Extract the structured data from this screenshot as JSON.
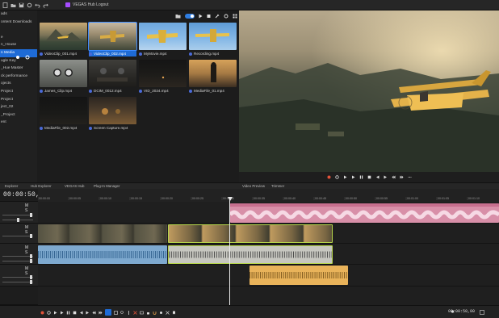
{
  "app": {
    "title": "VEGAS Hub Logout"
  },
  "colors": {
    "accent": "#1e6bd6",
    "record": "#e2533a",
    "pink_clip": "#d88fa8",
    "blue_clip": "#7ea9cf",
    "orange_clip": "#e9b35a",
    "video_clip_border": "#b7d64a"
  },
  "explorer": {
    "items": [
      {
        "label": "ads"
      },
      {
        "label": "ontent Downloads"
      },
      {
        "label": ""
      },
      {
        "label": "e"
      },
      {
        "label": "n_House"
      },
      {
        "label": "n Media",
        "selected": true
      },
      {
        "label": "ugle Key"
      },
      {
        "label": "_Hue Master"
      },
      {
        "label": "ck performance"
      },
      {
        "label": "ojects"
      },
      {
        "label": "Project"
      },
      {
        "label": "Project"
      },
      {
        "label": "ject_02"
      },
      {
        "label": "_Project"
      },
      {
        "label": "ent"
      }
    ]
  },
  "media_bin": {
    "items": [
      {
        "name": "VideoClip_001.mp4",
        "scene": "mountain-plane"
      },
      {
        "name": "VideoClip_002.mp4",
        "scene": "sunset-plane",
        "selected": true
      },
      {
        "name": "MyMovie.mp4",
        "scene": "sky-plane"
      },
      {
        "name": "Recording.mp4",
        "scene": "sky-plane2"
      },
      {
        "name": "James_Clip.mp4",
        "scene": "cockpit"
      },
      {
        "name": "DCIM_0012.mp4",
        "scene": "dark-cockpit"
      },
      {
        "name": "VID_2024.mp4",
        "scene": "night"
      },
      {
        "name": "MediaFile_01.mp4",
        "scene": "pilot"
      },
      {
        "name": "MediaFile_002.mp4",
        "scene": "dark-field"
      },
      {
        "name": "Screen Capture.mp4",
        "scene": "warm-cockpit"
      }
    ]
  },
  "dock_tabs": [
    {
      "label": "Explorer"
    },
    {
      "label": "Hub Explorer"
    },
    {
      "label": "VEGAS Hub"
    },
    {
      "label": "Plug-In Manager"
    },
    {
      "label": "Video Preview"
    },
    {
      "label": "Trimmer"
    }
  ],
  "timeline": {
    "timecode": "00:00:50,00",
    "end_time": "00:00:50,00",
    "ruler_labels": [
      "00:00:00",
      "00:00:05",
      "00:00:10",
      "00:00:15",
      "00:00:20",
      "00:00:25",
      "00:00:30",
      "00:00:35",
      "00:00:40",
      "00:00:45",
      "00:00:50",
      "00:00:55",
      "00:01:00",
      "00:01:05",
      "00:01:10"
    ],
    "track_label": "M S"
  }
}
